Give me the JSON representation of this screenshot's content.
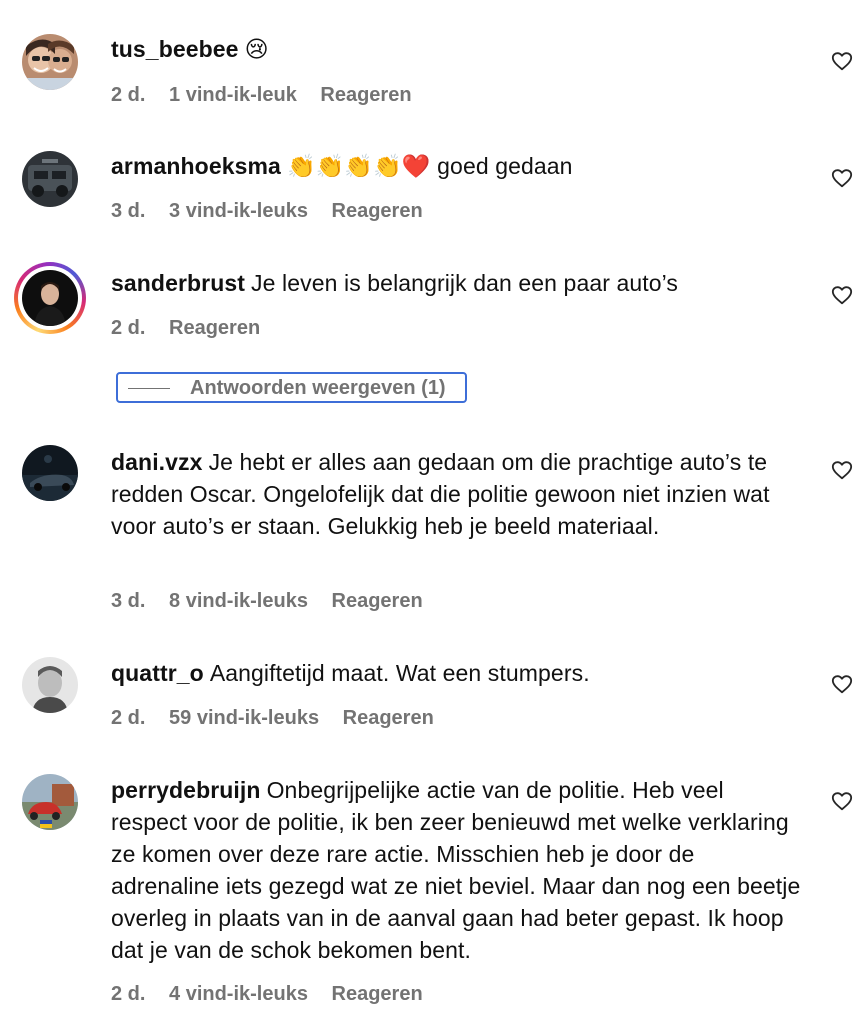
{
  "comments": [
    {
      "username": "tus_beebee",
      "text": "",
      "emoji": "😢",
      "time": "2 d.",
      "likes": "1 vind-ik-leuk",
      "reply": "Reageren"
    },
    {
      "username": "armanhoeksma",
      "emoji": "👏👏👏👏❤️",
      "text": "goed gedaan",
      "time": "3 d.",
      "likes": "3 vind-ik-leuks",
      "reply": "Reageren"
    },
    {
      "username": "sanderbrust",
      "text": "Je leven is belangrijk dan een paar auto’s",
      "time": "2 d.",
      "reply": "Reageren",
      "show_replies": "Antwoorden weergeven (1)"
    },
    {
      "username": "dani.vzx",
      "text": "Je hebt er alles aan gedaan om die prachtige auto’s te redden Oscar. Ongelofelijk dat die politie gewoon niet inzien wat voor auto’s er staan. Gelukkig heb je beeld materiaal.",
      "time": "3 d.",
      "likes": "8 vind-ik-leuks",
      "reply": "Reageren"
    },
    {
      "username": "quattr_o",
      "text": "Aangiftetijd maat. Wat een stumpers.",
      "time": "2 d.",
      "likes": "59 vind-ik-leuks",
      "reply": "Reageren"
    },
    {
      "username": "perrydebruijn",
      "text": "Onbegrijpelijke actie van de politie. Heb veel respect voor de politie, ik ben zeer benieuwd met welke verklaring ze komen over deze rare actie. Misschien heb je door de adrenaline iets gezegd wat ze niet beviel. Maar dan nog een beetje overleg in plaats van in de aanval gaan had beter gepast. Ik hoop dat je van de schok bekomen bent.",
      "time": "2 d.",
      "likes": "4 vind-ik-leuks",
      "reply": "Reageren"
    }
  ],
  "icons": {
    "like": "heart-outline-icon"
  },
  "colors": {
    "meta_text": "#737373",
    "focus_outline": "#3d6ed8",
    "story_ring": "#d62976"
  }
}
